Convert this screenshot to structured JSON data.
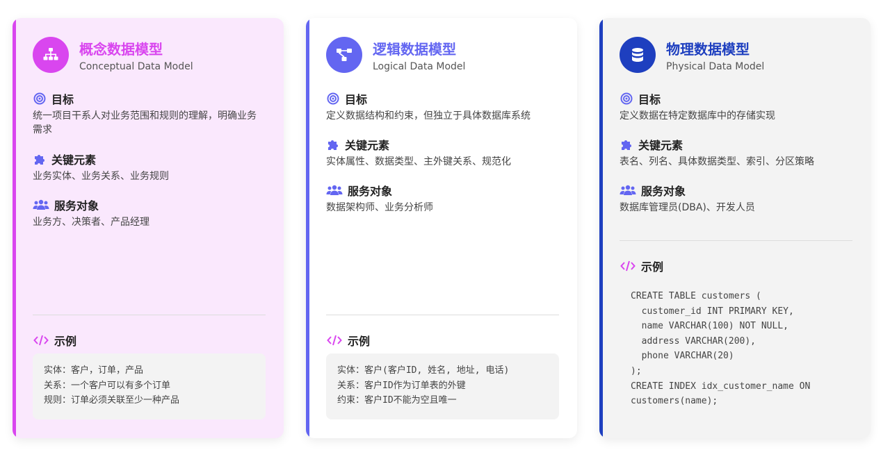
{
  "cards": [
    {
      "title": "概念数据模型",
      "subtitle": "Conceptual Data Model",
      "icon": "sitemap-icon",
      "accent": "#d946ef",
      "goal_label": "目标",
      "goal_text": "统一项目干系人对业务范围和规则的理解，明确业务需求",
      "elements_label": "关键元素",
      "elements_text": "业务实体、业务关系、业务规则",
      "audience_label": "服务对象",
      "audience_text": "业务方、决策者、产品经理",
      "example_label": "示例",
      "example_lines": [
        "实体：客户，订单，产品",
        "关系：一个客户可以有多个订单",
        "规则：订单必须关联至少一种产品"
      ]
    },
    {
      "title": "逻辑数据模型",
      "subtitle": "Logical Data Model",
      "icon": "project-diagram-icon",
      "accent": "#6366f1",
      "goal_label": "目标",
      "goal_text": "定义数据结构和约束，但独立于具体数据库系统",
      "elements_label": "关键元素",
      "elements_text": "实体属性、数据类型、主外键关系、规范化",
      "audience_label": "服务对象",
      "audience_text": "数据架构师、业务分析师",
      "example_label": "示例",
      "example_lines": [
        "实体：客户(客户ID, 姓名, 地址, 电话)",
        "关系：客户ID作为订单表的外键",
        "约束：客户ID不能为空且唯一"
      ]
    },
    {
      "title": "物理数据模型",
      "subtitle": "Physical Data Model",
      "icon": "database-icon",
      "accent": "#1e3fbf",
      "goal_label": "目标",
      "goal_text": "定义数据在特定数据库中的存储实现",
      "elements_label": "关键元素",
      "elements_text": "表名、列名、具体数据类型、索引、分区策略",
      "audience_label": "服务对象",
      "audience_text": "数据库管理员(DBA)、开发人员",
      "example_label": "示例",
      "example_lines": [
        "CREATE TABLE customers (",
        "  customer_id INT PRIMARY KEY,",
        "  name VARCHAR(100) NOT NULL,",
        "  address VARCHAR(200),",
        "  phone VARCHAR(20)",
        ");",
        "CREATE INDEX idx_customer_name ON",
        "customers(name);"
      ]
    }
  ],
  "icon_colors": {
    "section_icon": "#6366f1",
    "code_icon": "#d946ef"
  }
}
